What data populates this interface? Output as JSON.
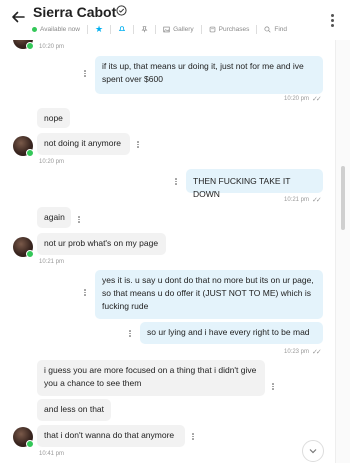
{
  "header": {
    "title": "Sierra Cabot",
    "status": "Available now",
    "gallery_label": "Gallery",
    "purchases_label": "Purchases",
    "find_label": "Find"
  },
  "messages": [
    {
      "id": "m0",
      "direction": "in",
      "time": "10:20 pm"
    },
    {
      "id": "m1",
      "direction": "out",
      "text": "if its up, that means ur doing it, just not for me and ive spent over $600",
      "time": "10:20 pm"
    },
    {
      "id": "m2",
      "direction": "in",
      "text": "nope"
    },
    {
      "id": "m3",
      "direction": "in",
      "text": "not doing it anymore",
      "time": "10:20 pm"
    },
    {
      "id": "m4",
      "direction": "out",
      "text": "THEN FUCKING TAKE IT DOWN",
      "time": "10:21 pm"
    },
    {
      "id": "m5",
      "direction": "in",
      "text": "again"
    },
    {
      "id": "m6",
      "direction": "in",
      "text": "not ur prob what's on my page",
      "time": "10:21 pm"
    },
    {
      "id": "m7",
      "direction": "out",
      "text": "yes it is. u say u dont do that no more but its on ur page, so that means u do offer it (JUST NOT TO ME) which is fucking rude"
    },
    {
      "id": "m8",
      "direction": "out",
      "text": "so ur lying and i have every right to be mad",
      "time": "10:23 pm"
    },
    {
      "id": "m9",
      "direction": "in",
      "text": "i guess you are more focused on a thing that i didn't give you a chance to see them"
    },
    {
      "id": "m10",
      "direction": "in",
      "text": "and less on that"
    },
    {
      "id": "m11",
      "direction": "in",
      "text": "that i don't wanna do that anymore",
      "time": "10:41 pm"
    }
  ]
}
